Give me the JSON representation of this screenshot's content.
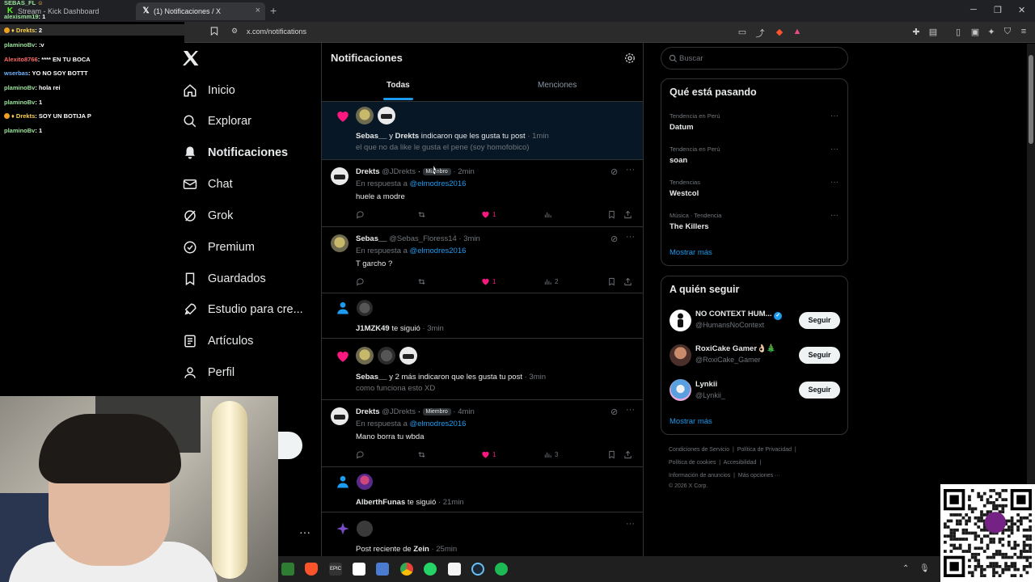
{
  "browser": {
    "tabs": [
      {
        "label": "Stream - Kick Dashboard",
        "icon": "kick-icon"
      },
      {
        "label": "(1) Notificaciones / X",
        "icon": "x-logo-icon"
      }
    ],
    "url": "x.com/notifications"
  },
  "chat": {
    "header_user": "SEBAS_FL",
    "lines": [
      {
        "user": "alexismm19",
        "text": "1"
      },
      {
        "user": "Drekts",
        "text": "2"
      },
      {
        "user": "plaminoBv",
        "text": ":v"
      },
      {
        "user": "Alexito8766",
        "text": "**** EN TU BOCA"
      },
      {
        "user": "wserbas",
        "text": "YO NO SOY BOTTT"
      },
      {
        "user": "plaminoBv",
        "text": "hola rei"
      },
      {
        "user": "plaminoBv",
        "text": "1"
      },
      {
        "user": "Drekts",
        "text": "SOY UN BOTIJA P"
      },
      {
        "user": "plaminoBv",
        "text": "1"
      }
    ]
  },
  "nav": {
    "items": [
      {
        "label": "Inicio",
        "icon": "home-icon"
      },
      {
        "label": "Explorar",
        "icon": "search-icon"
      },
      {
        "label": "Notificaciones",
        "icon": "bell-icon"
      },
      {
        "label": "Chat",
        "icon": "mail-icon"
      },
      {
        "label": "Grok",
        "icon": "grok-icon"
      },
      {
        "label": "Premium",
        "icon": "verified-icon"
      },
      {
        "label": "Guardados",
        "icon": "bookmark-icon"
      },
      {
        "label": "Estudio para cre...",
        "icon": "rocket-icon"
      },
      {
        "label": "Artículos",
        "icon": "article-icon"
      },
      {
        "label": "Perfil",
        "icon": "person-icon"
      }
    ],
    "more": "···"
  },
  "main": {
    "title": "Notificaciones",
    "tabs": [
      "Todas",
      "Menciones"
    ],
    "notifications": [
      {
        "type": "like",
        "names": "Sebas__",
        "joiner": " y ",
        "names2": "Drekts",
        "action": " indicaron que les gusta tu post",
        "time": "· 1min",
        "snippet": "el que no da like le gusta el pene (soy homofobico)"
      },
      {
        "type": "reply",
        "name": "Drekts",
        "handle": "@JDrekts",
        "badge": "Miembro",
        "time": "· 2min",
        "reply_label": "En respuesta a ",
        "reply_to": "@elmodres2016",
        "text": "huele a modre",
        "likes": "1",
        "views": ""
      },
      {
        "type": "reply",
        "name": "Sebas__",
        "handle": "@Sebas_Floress14",
        "time": "· 3min",
        "reply_label": "En respuesta a ",
        "reply_to": "@elmodres2016",
        "text": "T garcho ?",
        "likes": "1",
        "views": "2"
      },
      {
        "type": "follow",
        "name": "J1MZK49",
        "action": " te siguió",
        "time": "· 3min"
      },
      {
        "type": "like",
        "names": "Sebas__",
        "action": " y 2 más indicaron que les gusta tu post",
        "time": "· 3min",
        "snippet": "como funciona esto XD"
      },
      {
        "type": "reply",
        "name": "Drekts",
        "handle": "@JDrekts",
        "badge": "Miembro",
        "time": "· 4min",
        "reply_label": "En respuesta a ",
        "reply_to": "@elmodres2016",
        "text": "Mano borra tu wbda",
        "likes": "1",
        "views": "3"
      },
      {
        "type": "follow",
        "name": "AlberthFunas",
        "action": " te siguió",
        "time": "· 21min"
      },
      {
        "type": "post",
        "prefix": "Post reciente de ",
        "name": "Zein",
        "time": "· 25min"
      }
    ]
  },
  "sidebar": {
    "search_placeholder": "Buscar",
    "trends_title": "Qué está pasando",
    "trends": [
      {
        "context": "Tendencia en Perú",
        "name": "Datum"
      },
      {
        "context": "Tendencia en Perú",
        "name": "soan"
      },
      {
        "context": "Tendencias",
        "name": "Westcol"
      },
      {
        "context": "Música · Tendencia",
        "name": "The Killers"
      }
    ],
    "show_more": "Mostrar más",
    "follow_title": "A quién seguir",
    "follow": [
      {
        "name": "NO CONTEXT HUM...",
        "handle": "@HumansNoContext",
        "button": "Seguir"
      },
      {
        "name": "RoxiCake Gamer👌🏻🎄",
        "handle": "@RoxiCake_Gamer",
        "button": "Seguir"
      },
      {
        "name": "Lynkii",
        "handle": "@Lynkii_",
        "button": "Seguir"
      }
    ],
    "footer": {
      "l1a": "Condiciones de Servicio",
      "l1b": "Política de Privacidad",
      "l2a": "Política de cookies",
      "l2b": "Accesibilidad",
      "l3a": "Información de anuncios",
      "l3b": "Más opciones ···",
      "copy": "© 2026 X Corp."
    }
  },
  "colors": {
    "accent": "#1d9bf0",
    "like": "#f91880",
    "bg": "#000000",
    "border": "#2f3336"
  }
}
